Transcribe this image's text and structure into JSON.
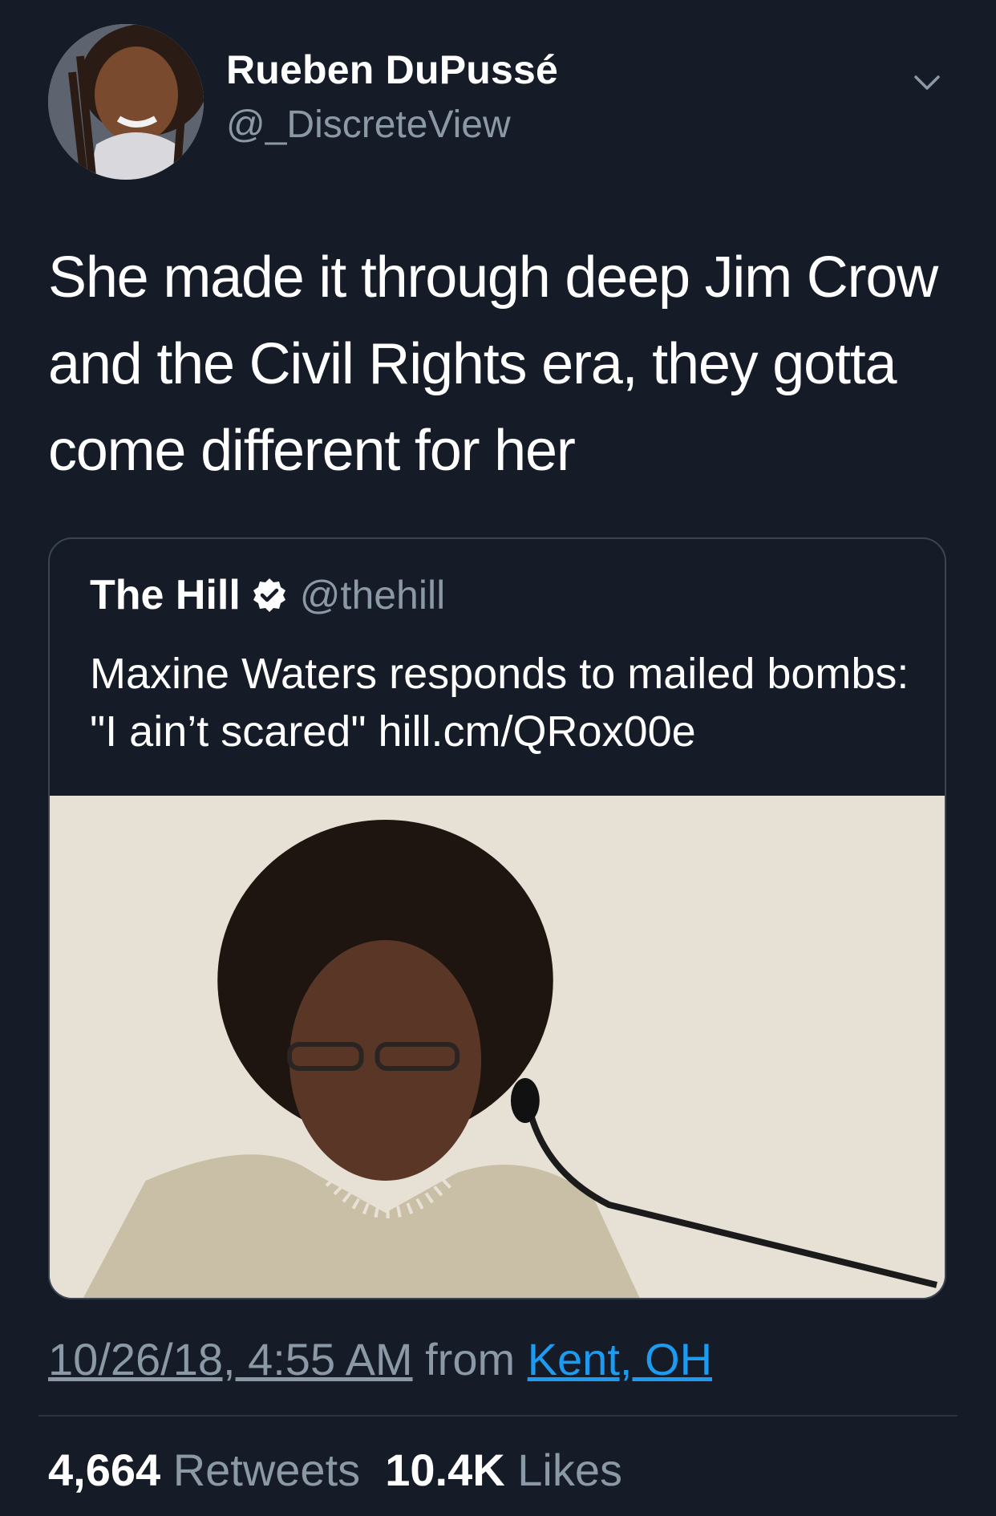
{
  "author": {
    "name": "Rueben DuPussé",
    "handle": "@_DiscreteView"
  },
  "tweet": {
    "text": "She made it through deep Jim Crow and the Civil Rights era, they gotta come different for her"
  },
  "quoted_tweet": {
    "name": "The Hill",
    "handle": "@thehill",
    "text": "Maxine Waters responds to mailed bombs: \"I ain’t scared\" hill.cm/QRox00e"
  },
  "meta": {
    "timestamp": "10/26/18, 4:55 AM",
    "from_label": "from",
    "location": "Kent, OH"
  },
  "stats": {
    "retweets_count": "4,664",
    "retweets_label": "Retweets",
    "likes_count": "10.4K",
    "likes_label": "Likes"
  },
  "icons": {
    "chevron": "chevron-down-icon",
    "verified": "verified-badge-icon"
  },
  "colors": {
    "background": "#151c27",
    "secondary_text": "#8b98a5",
    "link": "#1d9bf0",
    "border": "#3a4553"
  }
}
